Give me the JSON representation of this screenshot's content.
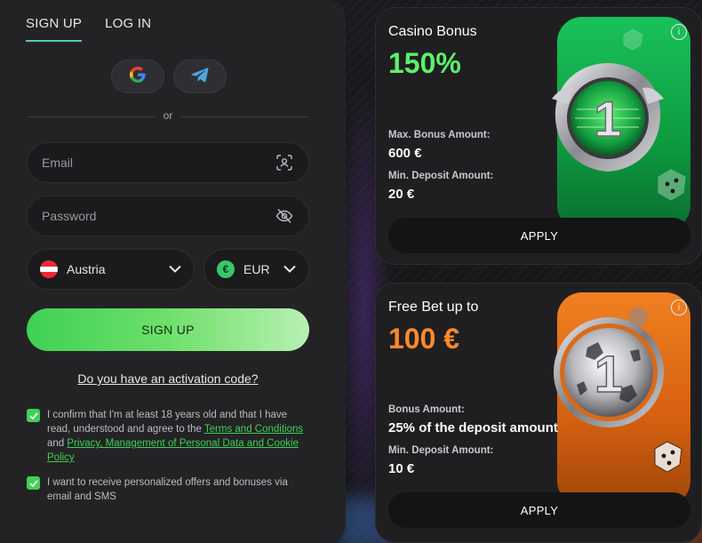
{
  "auth": {
    "tabs": [
      {
        "label": "SIGN UP",
        "active": true
      },
      {
        "label": "LOG IN",
        "active": false
      }
    ],
    "social": [
      {
        "icon": "google-icon"
      },
      {
        "icon": "telegram-icon"
      }
    ],
    "divider_text": "or",
    "email_placeholder": "Email",
    "password_placeholder": "Password",
    "country": {
      "label": "Austria",
      "flag_colors": [
        "#ed2939",
        "#ffffff",
        "#ed2939"
      ]
    },
    "currency": {
      "label": "EUR",
      "symbol": "€"
    },
    "signup_button": "SIGN UP",
    "activation_link": "Do you have an activation code?",
    "consent": {
      "checked": true,
      "text_before": "I confirm that I'm at least 18 years old and that I have read, understood and agree to the ",
      "link1": "Terms and Conditions",
      "text_middle": " and ",
      "link2": "Privacy, Management of Personal Data and Cookie Policy"
    },
    "offers": {
      "checked": true,
      "text": "I want to receive personalized offers and bonuses via email and SMS"
    }
  },
  "cards": [
    {
      "title": "Casino Bonus",
      "headline": "150%",
      "label1": "Max. Bonus Amount:",
      "value1": "600 €",
      "label2": "Min. Deposit Amount:",
      "value2": "20 €",
      "button": "APPLY",
      "info": "i"
    },
    {
      "title": "Free Bet up to",
      "headline": "100 €",
      "label1": "Bonus Amount:",
      "value1": "25% of the deposit amount",
      "label2": "Min. Deposit Amount:",
      "value2": "10 €",
      "button": "APPLY",
      "info": "i"
    }
  ],
  "colors": {
    "accent_green": "#3ed154",
    "casino_green": "#5ef06a",
    "freebet_orange": "#ff8a2a",
    "panel_bg": "#232325"
  }
}
